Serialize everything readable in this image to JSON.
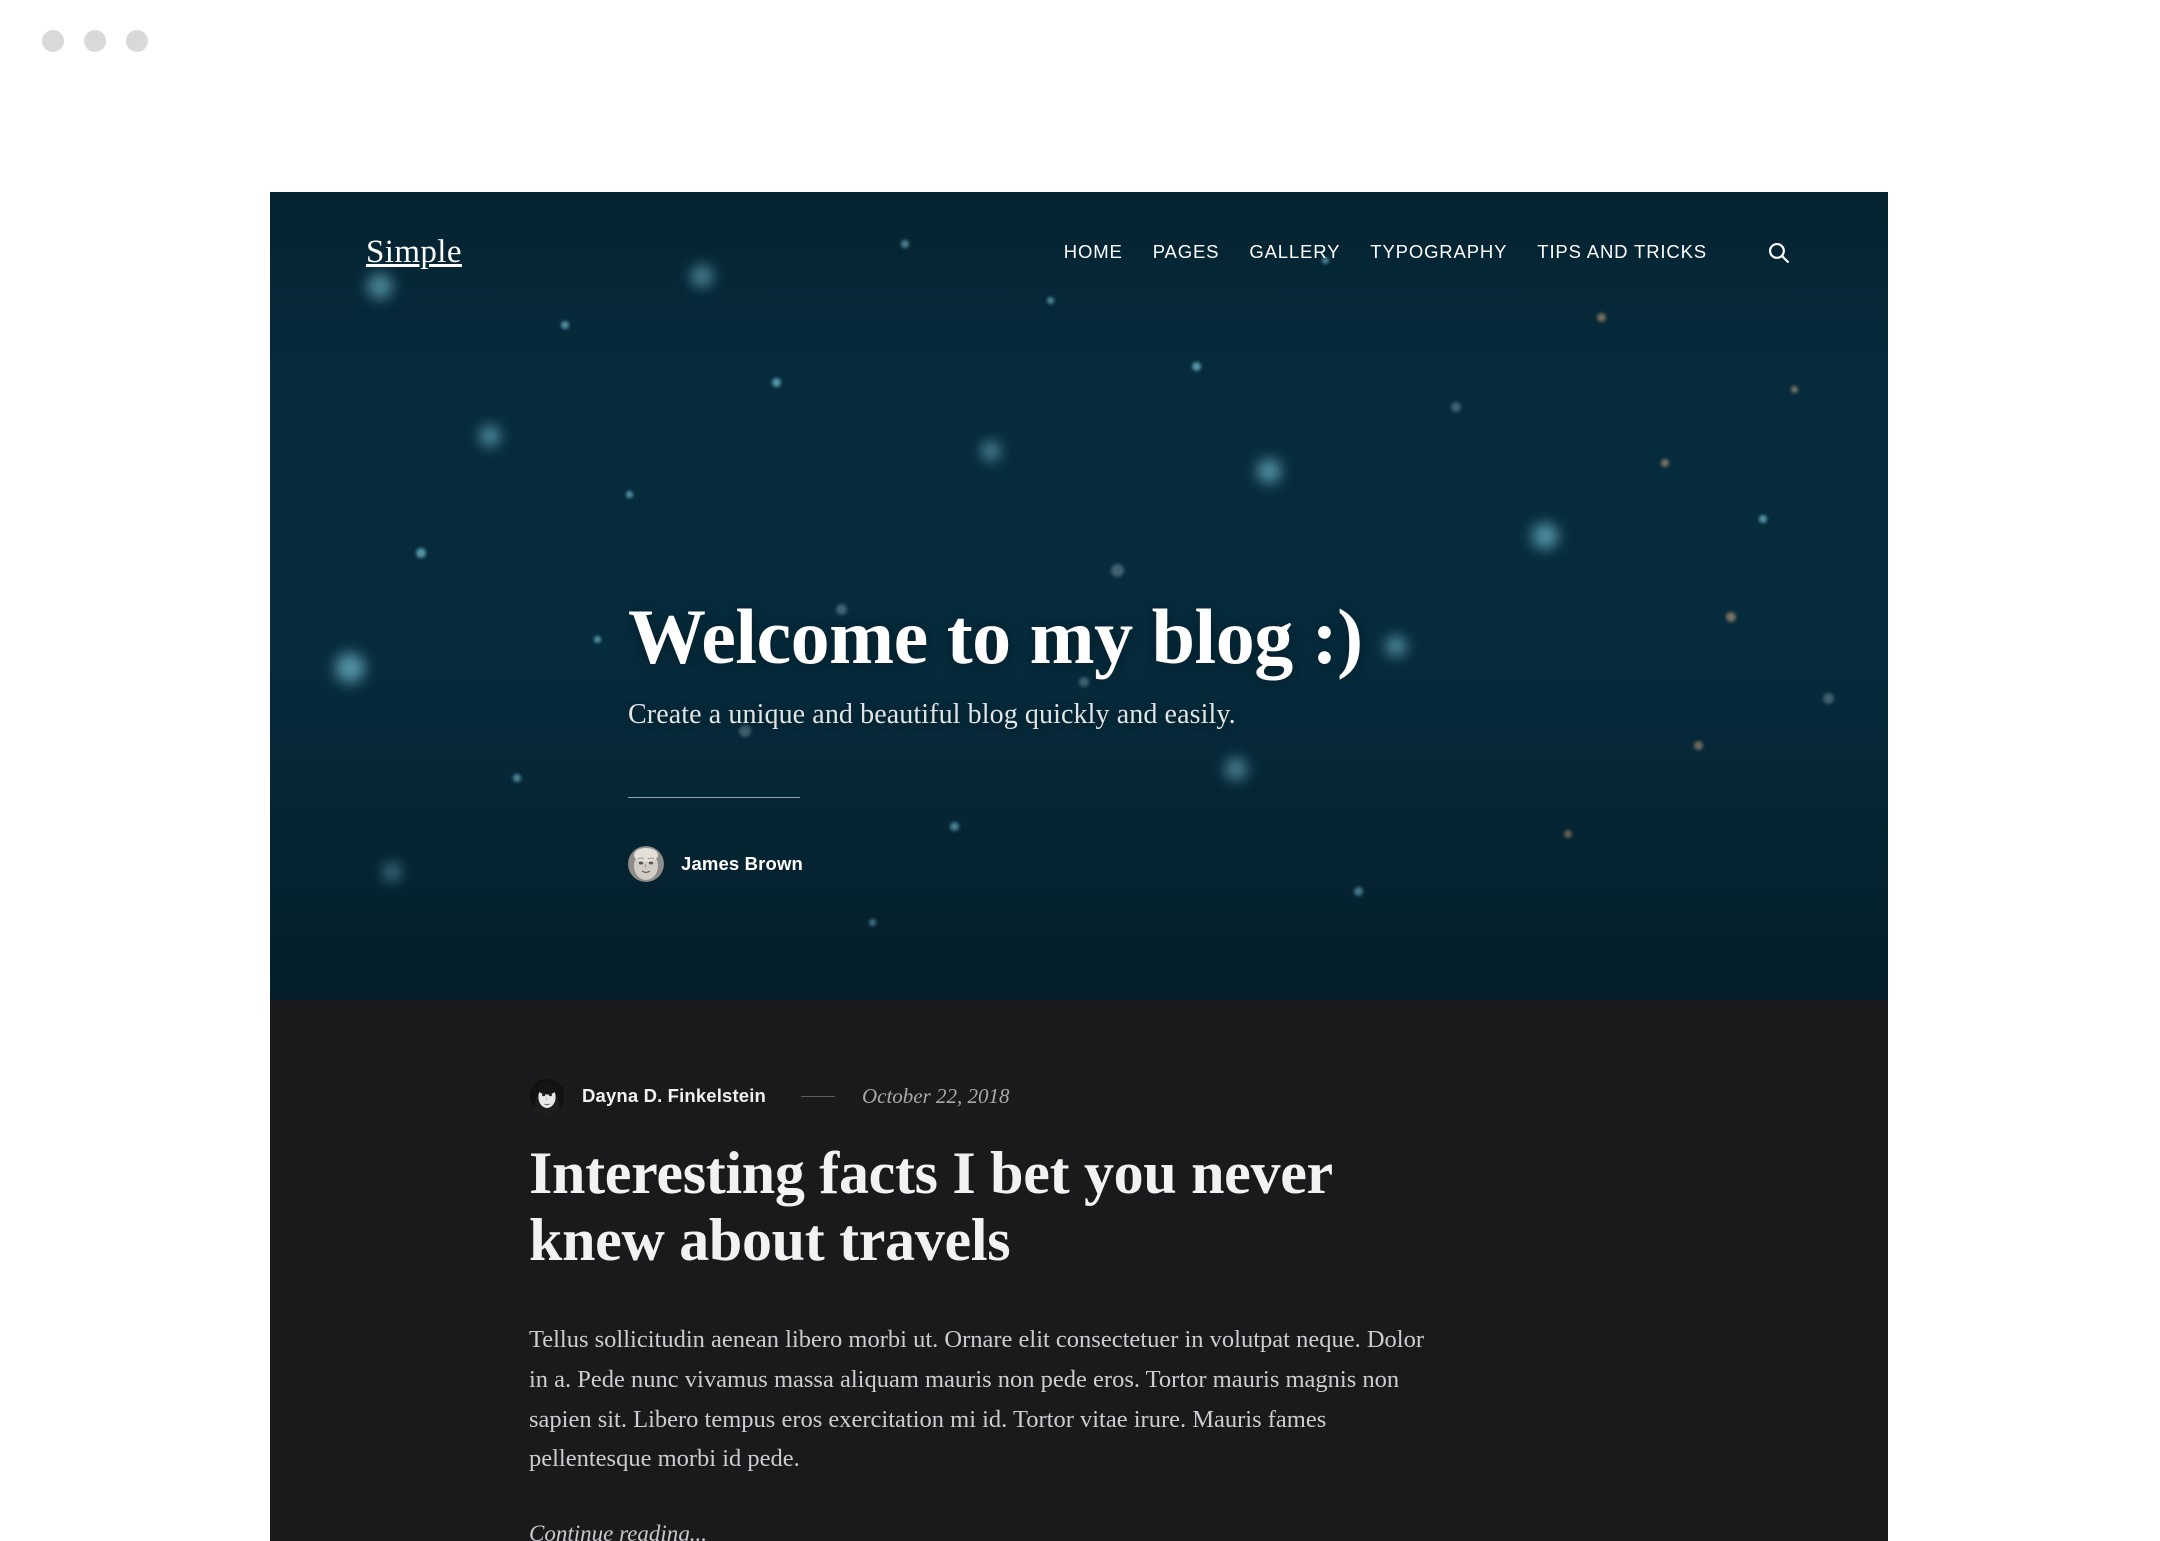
{
  "window": {
    "controls": [
      "close",
      "minimize",
      "maximize"
    ]
  },
  "header": {
    "logo": "Simple",
    "nav": [
      {
        "label": "HOME"
      },
      {
        "label": "PAGES"
      },
      {
        "label": "GALLERY"
      },
      {
        "label": "TYPOGRAPHY"
      },
      {
        "label": "TIPS AND TRICKS"
      }
    ],
    "search_icon": "search-icon"
  },
  "hero": {
    "title": "Welcome to my blog :)",
    "subtitle": "Create a unique and beautiful blog quickly and easily.",
    "author": "James Brown",
    "avatar_icon": "avatar-older-man"
  },
  "post": {
    "author": "Dayna D. Finkelstein",
    "date": "October 22, 2018",
    "avatar_icon": "avatar-woman",
    "title": "Interesting facts I bet you never knew about travels",
    "body": "Tellus sollicitudin aenean libero morbi ut. Ornare elit consectetuer in volutpat neque. Dolor in a. Pede nunc vivamus massa aliquam mauris non pede eros. Tortor mauris magnis non sapien sit. Libero tempus eros exercitation mi id. Tortor vitae irure. Mauris fames pellentesque morbi id pede.",
    "continue_label": "Continue reading..."
  },
  "colors": {
    "page_background": "#ffffff",
    "content_background": "#1a1a1d",
    "hero_teal": "#0d6186",
    "hero_dark": "#110f0f",
    "text_primary": "#f2f2f2",
    "text_muted": "#cdcdd1",
    "window_dot": "#d9d9db"
  }
}
